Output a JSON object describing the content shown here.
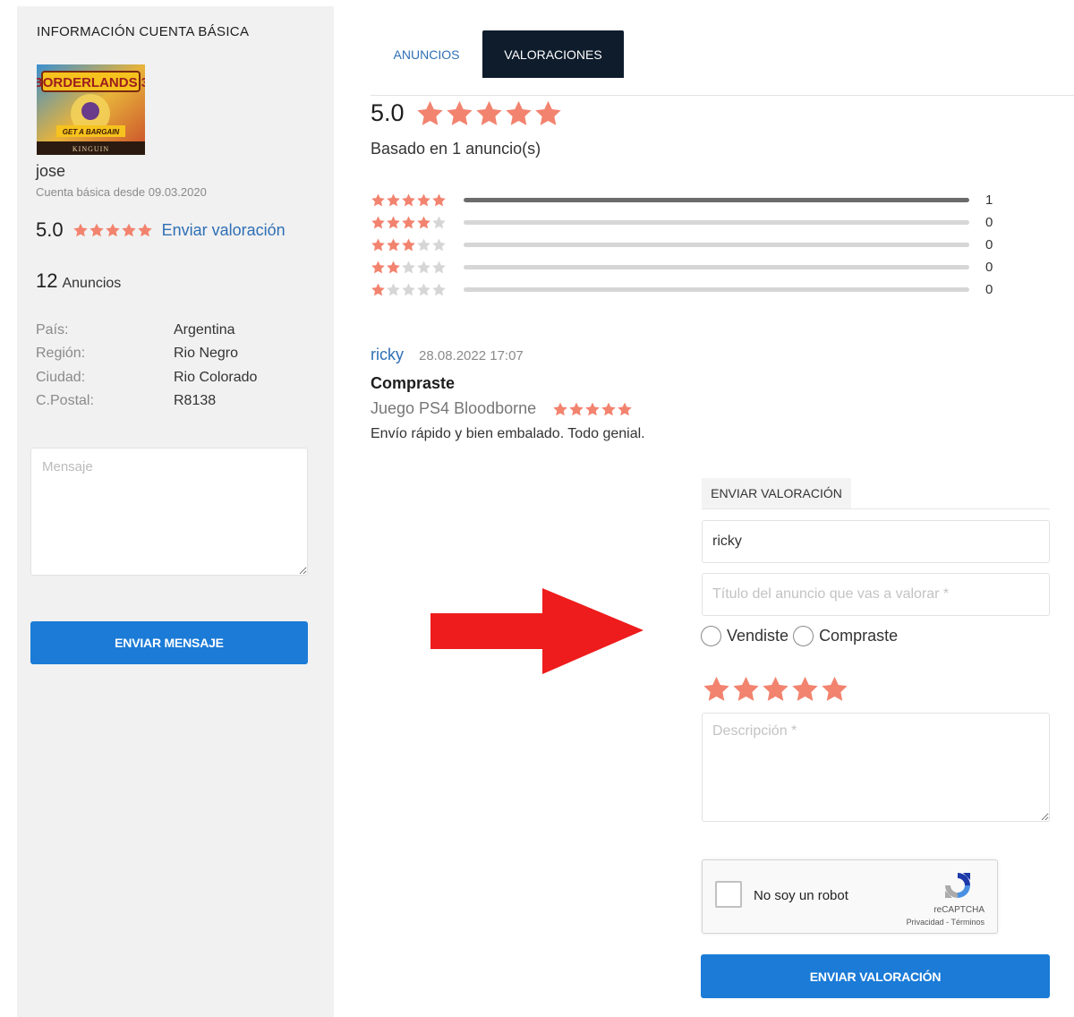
{
  "colors": {
    "accent_blue": "#1b7bd7",
    "link_blue": "#2f6fb5",
    "tab_active_bg": "#0e1c2c",
    "star_filled": "#f2836f",
    "star_empty": "#d6d6d6",
    "arrow_red": "#ee1c1c"
  },
  "sidebar": {
    "title": "INFORMACIÓN CUENTA BÁSICA",
    "avatar": {
      "icon": "game-cover-image",
      "caption": "BORDERLANDS 3",
      "tagline": "GET A BARGAIN",
      "brand": "KINGUIN"
    },
    "username": "jose",
    "member_since": "Cuenta básica desde 09.03.2020",
    "rating": {
      "value": "5.0",
      "stars": 5,
      "send_link": "Enviar valoración"
    },
    "ads": {
      "count": "12",
      "label": "Anuncios"
    },
    "info": [
      {
        "key": "País:",
        "value": "Argentina"
      },
      {
        "key": "Región:",
        "value": "Rio Negro"
      },
      {
        "key": "Ciudad:",
        "value": "Rio Colorado"
      },
      {
        "key": "C.Postal:",
        "value": "R8138"
      }
    ],
    "message_placeholder": "Mensaje",
    "send_message_label": "ENVIAR MENSAJE"
  },
  "main": {
    "tabs": [
      {
        "label": "ANUNCIOS",
        "active": false
      },
      {
        "label": "VALORACIONES",
        "active": true
      }
    ],
    "summary": {
      "value": "5.0",
      "stars": 5,
      "based_on": "Basado en 1 anuncio(s)"
    },
    "distribution": [
      {
        "stars": 5,
        "count": "1",
        "fraction": 1.0
      },
      {
        "stars": 4,
        "count": "0",
        "fraction": 0
      },
      {
        "stars": 3,
        "count": "0",
        "fraction": 0
      },
      {
        "stars": 2,
        "count": "0",
        "fraction": 0
      },
      {
        "stars": 1,
        "count": "0",
        "fraction": 0
      }
    ],
    "review": {
      "user": "ricky",
      "date": "28.08.2022 17:07",
      "type": "Compraste",
      "item_title": "Juego PS4 Bloodborne",
      "stars": 5,
      "text": "Envío rápido y bien embalado. Todo genial."
    }
  },
  "form": {
    "tab_label": "ENVIAR VALORACIÓN",
    "name_value": "ricky",
    "title_placeholder": "Título del anuncio que vas a valorar *",
    "radio_sold": "Vendiste",
    "radio_bought": "Compraste",
    "stars": 5,
    "description_placeholder": "Descripción *",
    "captcha": {
      "label": "No soy un robot",
      "brand": "reCAPTCHA",
      "links": "Privacidad - Términos"
    },
    "submit_label": "ENVIAR VALORACIÓN"
  }
}
